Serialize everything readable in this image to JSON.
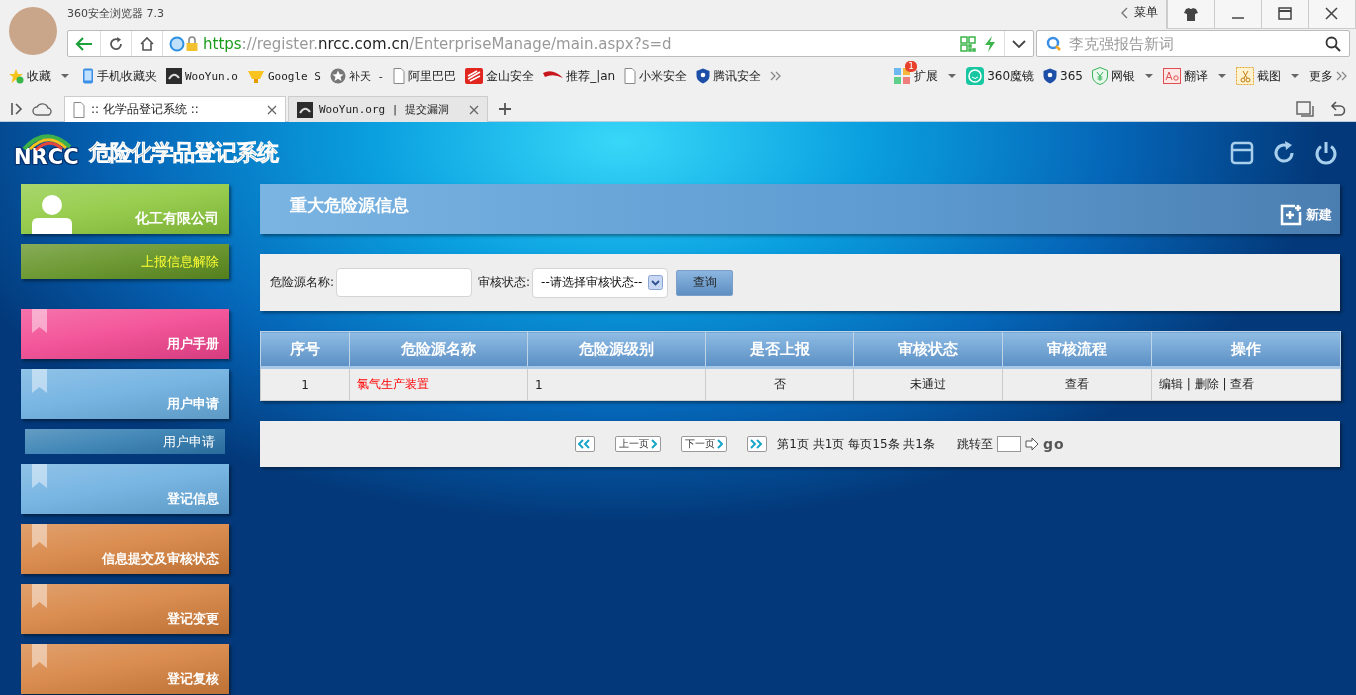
{
  "browser": {
    "title": "360安全浏览器 7.3",
    "menu_label": "菜单",
    "url_parts": [
      {
        "text": "https",
        "kind": "scheme"
      },
      {
        "text": "://register.",
        "kind": "plain"
      },
      {
        "text": "nrcc.com.cn",
        "kind": "domain"
      },
      {
        "text": "/EnterpriseManage/main.aspx?s=d",
        "kind": "plain"
      }
    ],
    "search": {
      "placeholder": "李克强报告新词"
    },
    "bookmarks": [
      {
        "label": "收藏",
        "kind": "star",
        "menu": true
      },
      {
        "label": "手机收藏夹",
        "kind": "phone",
        "menu": false
      },
      {
        "label": "WooYun.o",
        "kind": "square",
        "menu": false
      },
      {
        "label": "Google S",
        "kind": "cup",
        "menu": false
      },
      {
        "label": "补天 -",
        "kind": "badge",
        "menu": false
      },
      {
        "label": "阿里巴巴",
        "kind": "page",
        "menu": false
      },
      {
        "label": "金山安全",
        "kind": "logo",
        "menu": false
      },
      {
        "label": "推荐_|an",
        "kind": "swoosh",
        "menu": false
      },
      {
        "label": "小米安全",
        "kind": "page",
        "menu": false
      },
      {
        "label": "腾讯安全",
        "kind": "shield",
        "menu": false
      }
    ],
    "tools": [
      {
        "label": "扩展",
        "kind": "grid",
        "menu": true,
        "badge": "1"
      },
      {
        "label": "360魔镜",
        "kind": "face",
        "menu": false
      },
      {
        "label": "365",
        "kind": "shield",
        "menu": false
      },
      {
        "label": "网银",
        "kind": "money",
        "menu": true
      },
      {
        "label": "翻译",
        "kind": "letters",
        "menu": true
      },
      {
        "label": "截图",
        "kind": "scissors",
        "menu": true
      },
      {
        "label": "更多",
        "kind": "more",
        "menu": false
      }
    ],
    "tabs": [
      {
        "label": ":: 化学品登记系统 ::",
        "kind": "page",
        "selected": true
      },
      {
        "label": "WooYun.org | 提交漏洞",
        "kind": "square",
        "selected": false
      }
    ]
  },
  "app": {
    "logo": "NRCC",
    "title": "危险化学品登记系统",
    "sidebar": {
      "user": "化工有限公司",
      "items": [
        {
          "label": "上报信息解除",
          "kind": "report",
          "color": "#5f9020"
        },
        {
          "label": "用户手册",
          "kind": "tile",
          "color": "#f2448f"
        },
        {
          "label": "用户申请",
          "kind": "tile",
          "color": "#6aaee0"
        },
        {
          "label": "用户申请",
          "kind": "sub",
          "color": "#2f7bb0"
        },
        {
          "label": "登记信息",
          "kind": "tile",
          "color": "#6aaee0"
        },
        {
          "label": "信息提交及审核状态",
          "kind": "tile",
          "color": "#d6803c"
        },
        {
          "label": "登记变更",
          "kind": "tile",
          "color": "#d6803c"
        },
        {
          "label": "登记复核",
          "kind": "tile",
          "color": "#d6803c"
        }
      ]
    },
    "panel_title": "重大危险源信息",
    "new_button": "新建",
    "filter": {
      "name_label": "危险源名称:",
      "status_label": "审核状态:",
      "status_value": "--请选择审核状态--",
      "query_button": "查询"
    },
    "table": {
      "columns": [
        "序号",
        "危险源名称",
        "危险源级别",
        "是否上报",
        "审核状态",
        "审核流程",
        "操作"
      ],
      "rows": [
        {
          "cells": [
            "1",
            "氯气生产装置",
            "1",
            "否",
            "未通过",
            "查看"
          ],
          "actions": [
            "编辑",
            "删除",
            "查看"
          ],
          "separator": "|"
        }
      ]
    },
    "pager": {
      "prev": "上一页",
      "next": "下一页",
      "info": "第1页 共1页 每页15条 共1条",
      "jump_label": "跳转至",
      "go": "go"
    }
  }
}
